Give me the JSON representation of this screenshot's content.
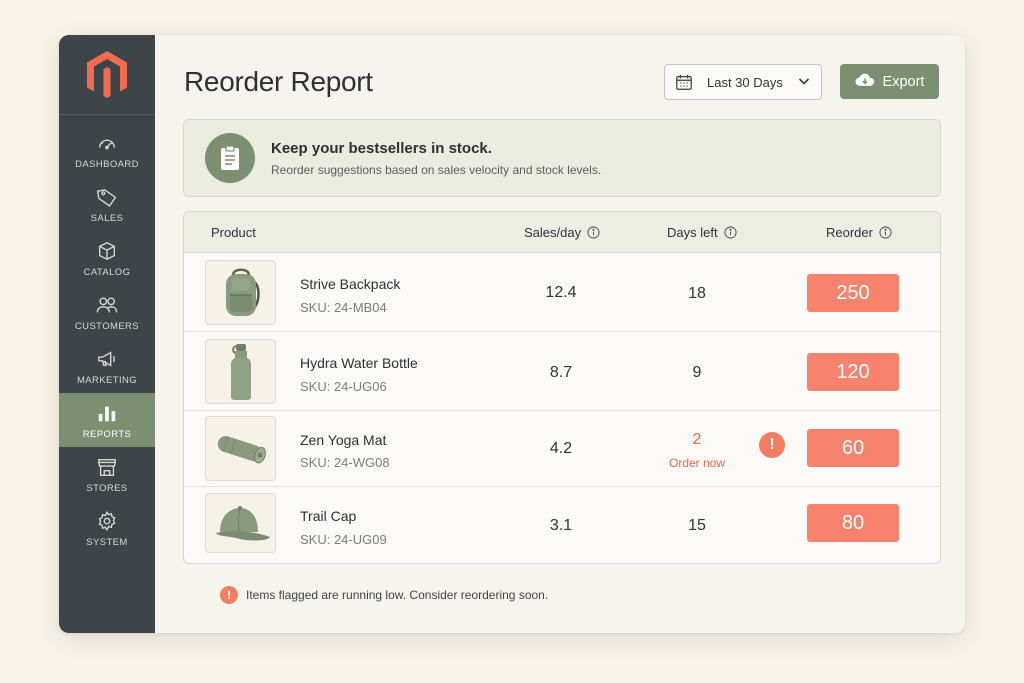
{
  "colors": {
    "sidebar": "#3d4548",
    "accent": "#7c8f71",
    "logo": "#f26b4f",
    "reorder": "#f7836e",
    "alert": "#e8654c"
  },
  "sidebar": {
    "logo_icon": "magento-logo-icon",
    "items": [
      {
        "label": "DASHBOARD",
        "icon": "gauge-icon",
        "active": false
      },
      {
        "label": "SALES",
        "icon": "tag-icon",
        "active": false
      },
      {
        "label": "CATALOG",
        "icon": "box-icon",
        "active": false
      },
      {
        "label": "CUSTOMERS",
        "icon": "users-icon",
        "active": false
      },
      {
        "label": "MARKETING",
        "icon": "megaphone-icon",
        "active": false
      },
      {
        "label": "REPORTS",
        "icon": "bar-chart-icon",
        "active": true
      },
      {
        "label": "STORES",
        "icon": "storefront-icon",
        "active": false
      },
      {
        "label": "SYSTEM",
        "icon": "gear-icon",
        "active": false
      }
    ]
  },
  "header": {
    "title": "Reorder Report",
    "date_range": "Last 30 Days",
    "export_label": "Export"
  },
  "banner": {
    "title": "Keep your bestsellers in stock.",
    "subtitle": "Reorder suggestions based on sales velocity and stock levels."
  },
  "table": {
    "columns": {
      "product": "Product",
      "sales": "Sales/day",
      "days": "Days left",
      "reorder": "Reorder"
    },
    "rows": [
      {
        "name": "Strive Backpack",
        "sku": "SKU: 24-MB04",
        "sales": "12.4",
        "days": "18",
        "reorder": "250",
        "note": "",
        "flagged": false,
        "image": "backpack"
      },
      {
        "name": "Hydra Water Bottle",
        "sku": "SKU: 24-UG06",
        "sales": "8.7",
        "days": "9",
        "reorder": "120",
        "note": "",
        "flagged": false,
        "image": "bottle"
      },
      {
        "name": "Zen Yoga Mat",
        "sku": "SKU: 24-WG08",
        "sales": "4.2",
        "days": "2",
        "reorder": "60",
        "note": "Order now",
        "flagged": true,
        "image": "yoga-mat"
      },
      {
        "name": "Trail Cap",
        "sku": "SKU: 24-UG09",
        "sales": "3.1",
        "days": "15",
        "reorder": "80",
        "note": "",
        "flagged": false,
        "image": "cap"
      }
    ]
  },
  "footnote": {
    "mark": "!",
    "text": "Items flagged are running low. Consider reordering soon."
  }
}
